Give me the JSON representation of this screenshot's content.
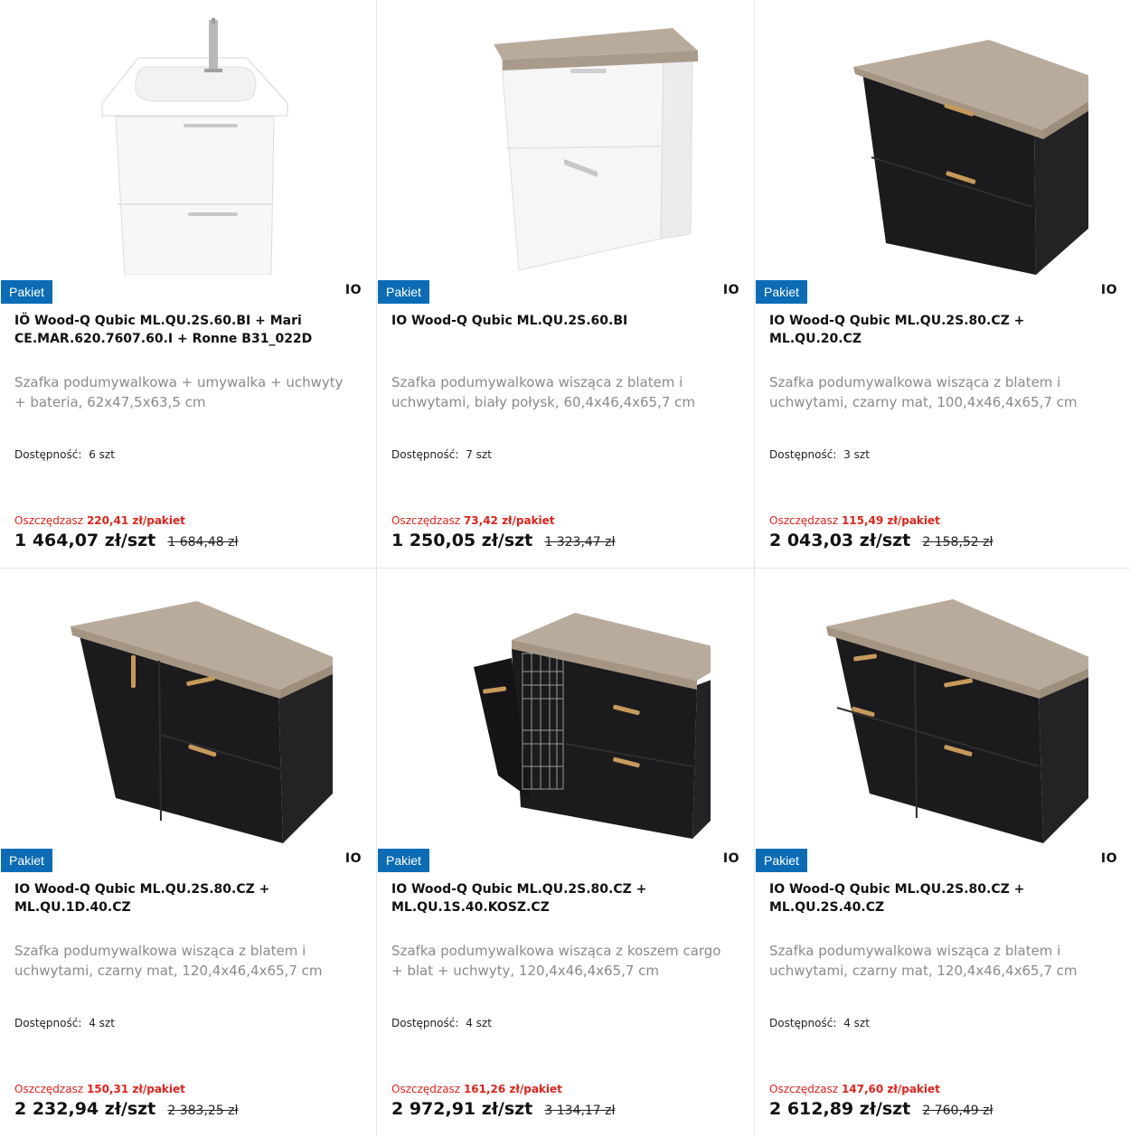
{
  "colors": {
    "badge": "#0b6cb5",
    "savings": "#e2231a",
    "worktop": "#b9ab9c",
    "black_cabinet": "#1b1b1d",
    "white_cabinet": "#f7f7f7",
    "handle": "#c79a5a"
  },
  "products": [
    {
      "badge": "Pakiet",
      "brand": "IO",
      "title": "IÖ Wood-Q Qubic ML.QU.2S.60.BI + Mari CE.MAR.620.7607.60.I + Ronne B31_022D",
      "description": "Szafka podumywalkowa + umywalka + uchwyty + bateria, 62x47,5x63,5 cm",
      "availability_label": "Dostępność:",
      "availability": "6 szt",
      "save_label": "Oszczędzasz",
      "save_amount": "220,41 zł/pakiet",
      "price": "1 464,07 zł/szt",
      "old_price": "1 684,48 zł",
      "image_icon": "white-vanity-with-basin-icon"
    },
    {
      "badge": "Pakiet",
      "brand": "IO",
      "title": "IO Wood-Q Qubic ML.QU.2S.60.BI",
      "description": "Szafka podumywalkowa wisząca z blatem i uchwytami, biały połysk, 60,4x46,4x65,7 cm",
      "availability_label": "Dostępność:",
      "availability": "7 szt",
      "save_label": "Oszczędzasz",
      "save_amount": "73,42 zł/pakiet",
      "price": "1 250,05 zł/szt",
      "old_price": "1 323,47 zł",
      "image_icon": "white-vanity-with-worktop-icon"
    },
    {
      "badge": "Pakiet",
      "brand": "IO",
      "title": "IO Wood-Q Qubic ML.QU.2S.80.CZ + ML.QU.20.CZ",
      "description": "Szafka podumywalkowa wisząca z blatem i uchwytami, czarny mat, 100,4x46,4x65,7 cm",
      "availability_label": "Dostępność:",
      "availability": "3 szt",
      "save_label": "Oszczędzasz",
      "save_amount": "115,49 zł/pakiet",
      "price": "2 043,03 zł/szt",
      "old_price": "2 158,52 zł",
      "image_icon": "black-vanity-with-shelf-icon"
    },
    {
      "badge": "Pakiet",
      "brand": "IO",
      "title": "IO Wood-Q Qubic ML.QU.2S.80.CZ + ML.QU.1D.40.CZ",
      "description": "Szafka podumywalkowa wisząca z blatem i uchwytami, czarny mat, 120,4x46,4x65,7 cm",
      "availability_label": "Dostępność:",
      "availability": "4 szt",
      "save_label": "Oszczędzasz",
      "save_amount": "150,31 zł/pakiet",
      "price": "2 232,94 zł/szt",
      "old_price": "2 383,25 zł",
      "image_icon": "black-vanity-with-door-icon"
    },
    {
      "badge": "Pakiet",
      "brand": "IO",
      "title": "IO Wood-Q Qubic ML.QU.2S.80.CZ + ML.QU.1S.40.KOSZ.CZ",
      "description": "Szafka podumywalkowa wisząca z koszem cargo + blat + uchwyty, 120,4x46,4x65,7 cm",
      "availability_label": "Dostępność:",
      "availability": "4 szt",
      "save_label": "Oszczędzasz",
      "save_amount": "161,26 zł/pakiet",
      "price": "2 972,91 zł/szt",
      "old_price": "3 134,17 zł",
      "image_icon": "black-vanity-with-cargo-basket-icon"
    },
    {
      "badge": "Pakiet",
      "brand": "IO",
      "title": "IO Wood-Q Qubic ML.QU.2S.80.CZ + ML.QU.2S.40.CZ",
      "description": "Szafka podumywalkowa wisząca z blatem i uchwytami, czarny mat, 120,4x46,4x65,7 cm",
      "availability_label": "Dostępność:",
      "availability": "4 szt",
      "save_label": "Oszczędzasz",
      "save_amount": "147,60 zł/pakiet",
      "price": "2 612,89 zł/szt",
      "old_price": "2 760,49 zł",
      "image_icon": "black-vanity-four-drawers-icon"
    }
  ]
}
